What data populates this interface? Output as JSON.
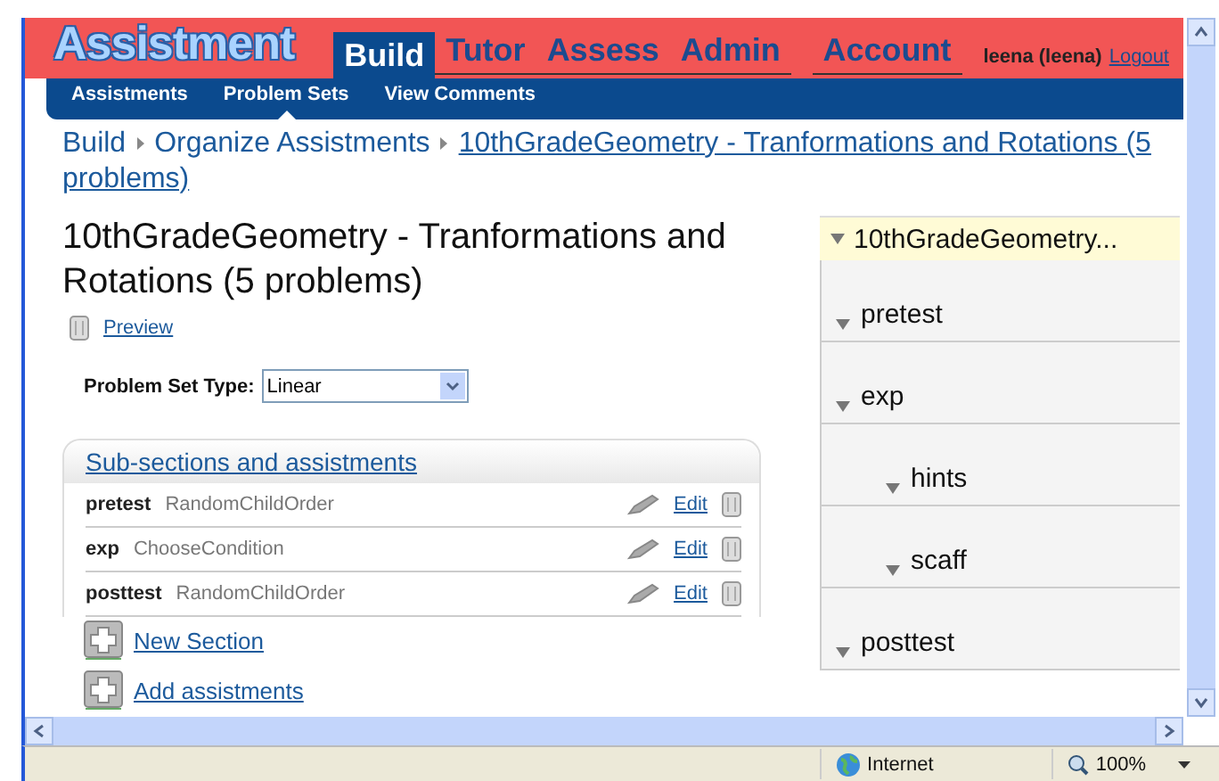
{
  "header": {
    "logo": "Assistment",
    "tabs": [
      {
        "label": "Build",
        "selected": true
      },
      {
        "label": "Tutor",
        "selected": false
      },
      {
        "label": "Assess",
        "selected": false
      },
      {
        "label": "Admin",
        "selected": false
      }
    ],
    "account": "Account",
    "user": "leena (leena)",
    "logout": "Logout"
  },
  "subnav": [
    {
      "label": "Assistments",
      "selected": false
    },
    {
      "label": "Problem Sets",
      "selected": true
    },
    {
      "label": "View Comments",
      "selected": false
    }
  ],
  "breadcrumb": [
    {
      "label": "Build",
      "kind": "plain"
    },
    {
      "label": "Organize Assistments",
      "kind": "plain"
    },
    {
      "label": "10thGradeGeometry - Tranformations and Rotations (5 problems)",
      "kind": "link"
    }
  ],
  "title": "10thGradeGeometry - Tranformations and Rotations (5 problems)",
  "preview": "Preview",
  "problem_set_type": {
    "label": "Problem Set Type:",
    "value": "Linear"
  },
  "sections": {
    "title": "Sub-sections and assistments",
    "rows": [
      {
        "name": "pretest",
        "order": "RandomChildOrder",
        "edit": "Edit"
      },
      {
        "name": "exp",
        "order": "ChooseCondition",
        "edit": "Edit"
      },
      {
        "name": "posttest",
        "order": "RandomChildOrder",
        "edit": "Edit"
      }
    ]
  },
  "actions": [
    "New Section",
    "Add assistments"
  ],
  "tree": {
    "root": "10thGradeGeometry...",
    "children": [
      {
        "label": "pretest"
      },
      {
        "label": "exp",
        "children": [
          {
            "label": "hints"
          },
          {
            "label": "scaff"
          }
        ]
      },
      {
        "label": "posttest"
      }
    ]
  },
  "status_bar": {
    "zone": "Internet",
    "zoom": "100%"
  }
}
